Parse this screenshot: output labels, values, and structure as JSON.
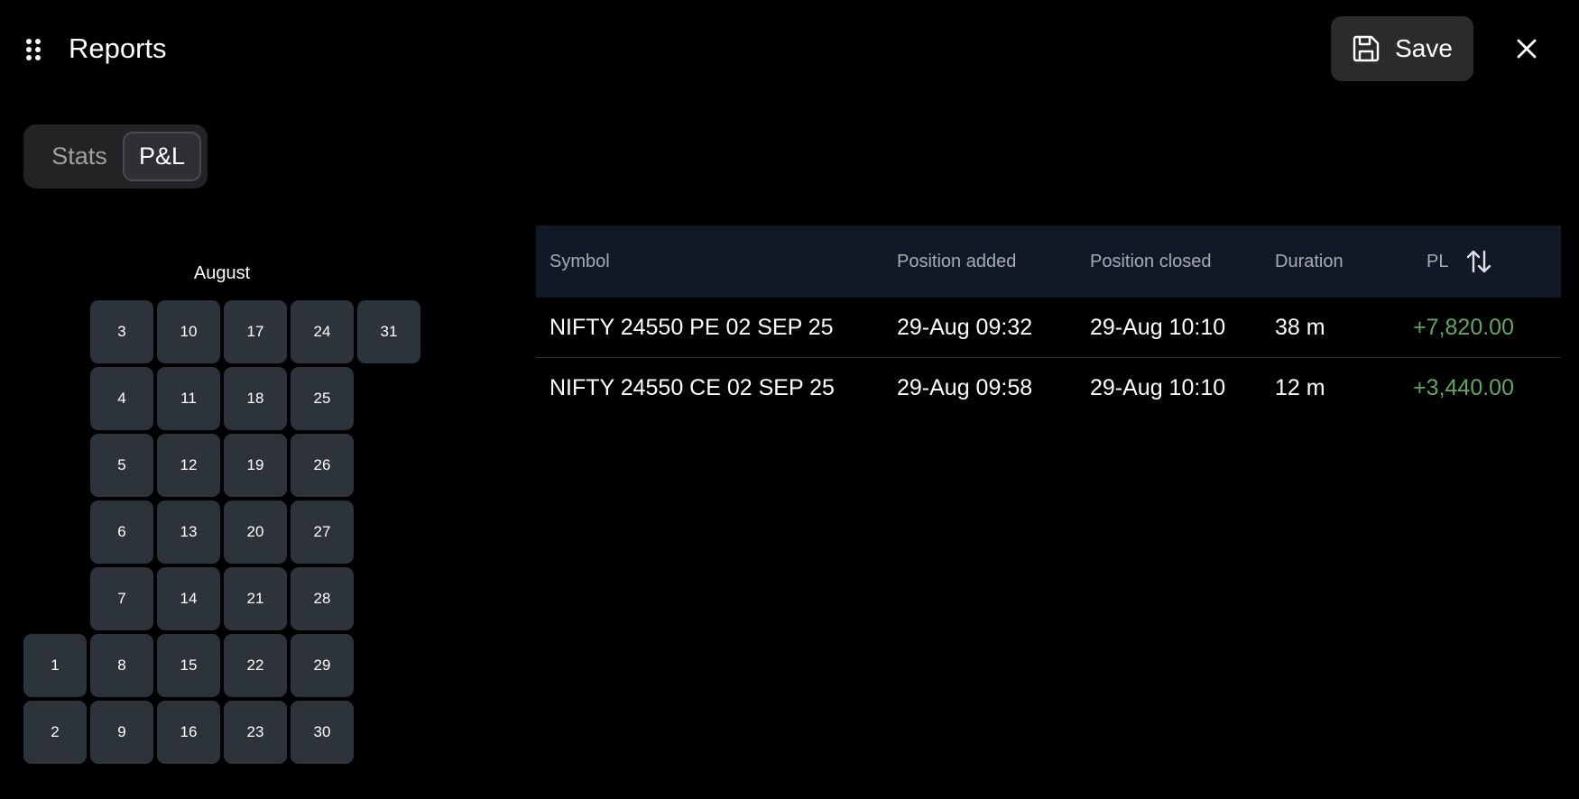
{
  "header": {
    "title": "Reports",
    "save_label": "Save",
    "drag_icon": "grip-dots-icon",
    "save_icon": "save-icon",
    "close_icon": "close-icon"
  },
  "tabs": {
    "items": [
      {
        "label": "Stats",
        "active": false
      },
      {
        "label": "P&L",
        "active": true
      }
    ]
  },
  "calendar": {
    "month": "August",
    "days": [
      "1",
      "2",
      "3",
      "4",
      "5",
      "6",
      "7",
      "8",
      "9",
      "10",
      "11",
      "12",
      "13",
      "14",
      "15",
      "16",
      "17",
      "18",
      "19",
      "20",
      "21",
      "22",
      "23",
      "24",
      "25",
      "26",
      "27",
      "28",
      "29",
      "30",
      "31"
    ]
  },
  "table": {
    "columns": [
      "Symbol",
      "Position added",
      "Position closed",
      "Duration",
      "PL"
    ],
    "sort_icon": "sort-arrows-icon",
    "rows": [
      {
        "symbol": "NIFTY 24550 PE 02 SEP 25",
        "added": "29-Aug 09:32",
        "closed": "29-Aug 10:10",
        "duration": "38 m",
        "pl": "+7,820.00"
      },
      {
        "symbol": "NIFTY 24550 CE 02 SEP 25",
        "added": "29-Aug 09:58",
        "closed": "29-Aug 10:10",
        "duration": "12 m",
        "pl": "+3,440.00"
      }
    ]
  },
  "colors": {
    "background": "#000000",
    "cell": "#2d333b",
    "table_header": "#111826",
    "profit": "#5fa85e"
  }
}
